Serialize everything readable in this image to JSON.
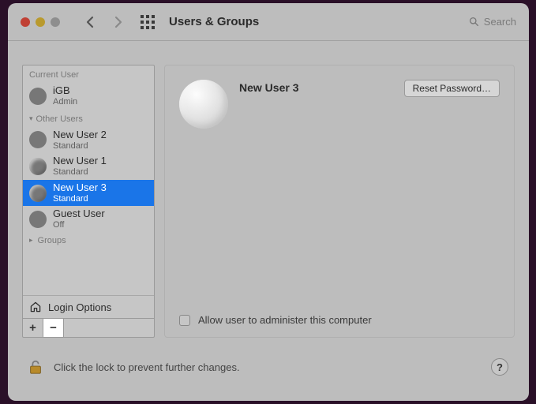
{
  "window": {
    "title": "Users & Groups",
    "search_placeholder": "Search"
  },
  "sidebar": {
    "current_label": "Current User",
    "other_label": "Other Users",
    "groups_label": "Groups",
    "login_options_label": "Login Options",
    "add_symbol": "+",
    "remove_symbol": "−",
    "current_user": {
      "name": "iGB",
      "role": "Admin"
    },
    "other_users": [
      {
        "name": "New User 2",
        "role": "Standard"
      },
      {
        "name": "New User 1",
        "role": "Standard"
      },
      {
        "name": "New User 3",
        "role": "Standard",
        "selected": true
      },
      {
        "name": "Guest User",
        "role": "Off"
      }
    ]
  },
  "main": {
    "selected_user_name": "New User 3",
    "reset_password_label": "Reset Password…",
    "admin_checkbox_label": "Allow user to administer this computer",
    "admin_checked": false
  },
  "footer": {
    "lock_text": "Click the lock to prevent further changes.",
    "help_symbol": "?"
  }
}
